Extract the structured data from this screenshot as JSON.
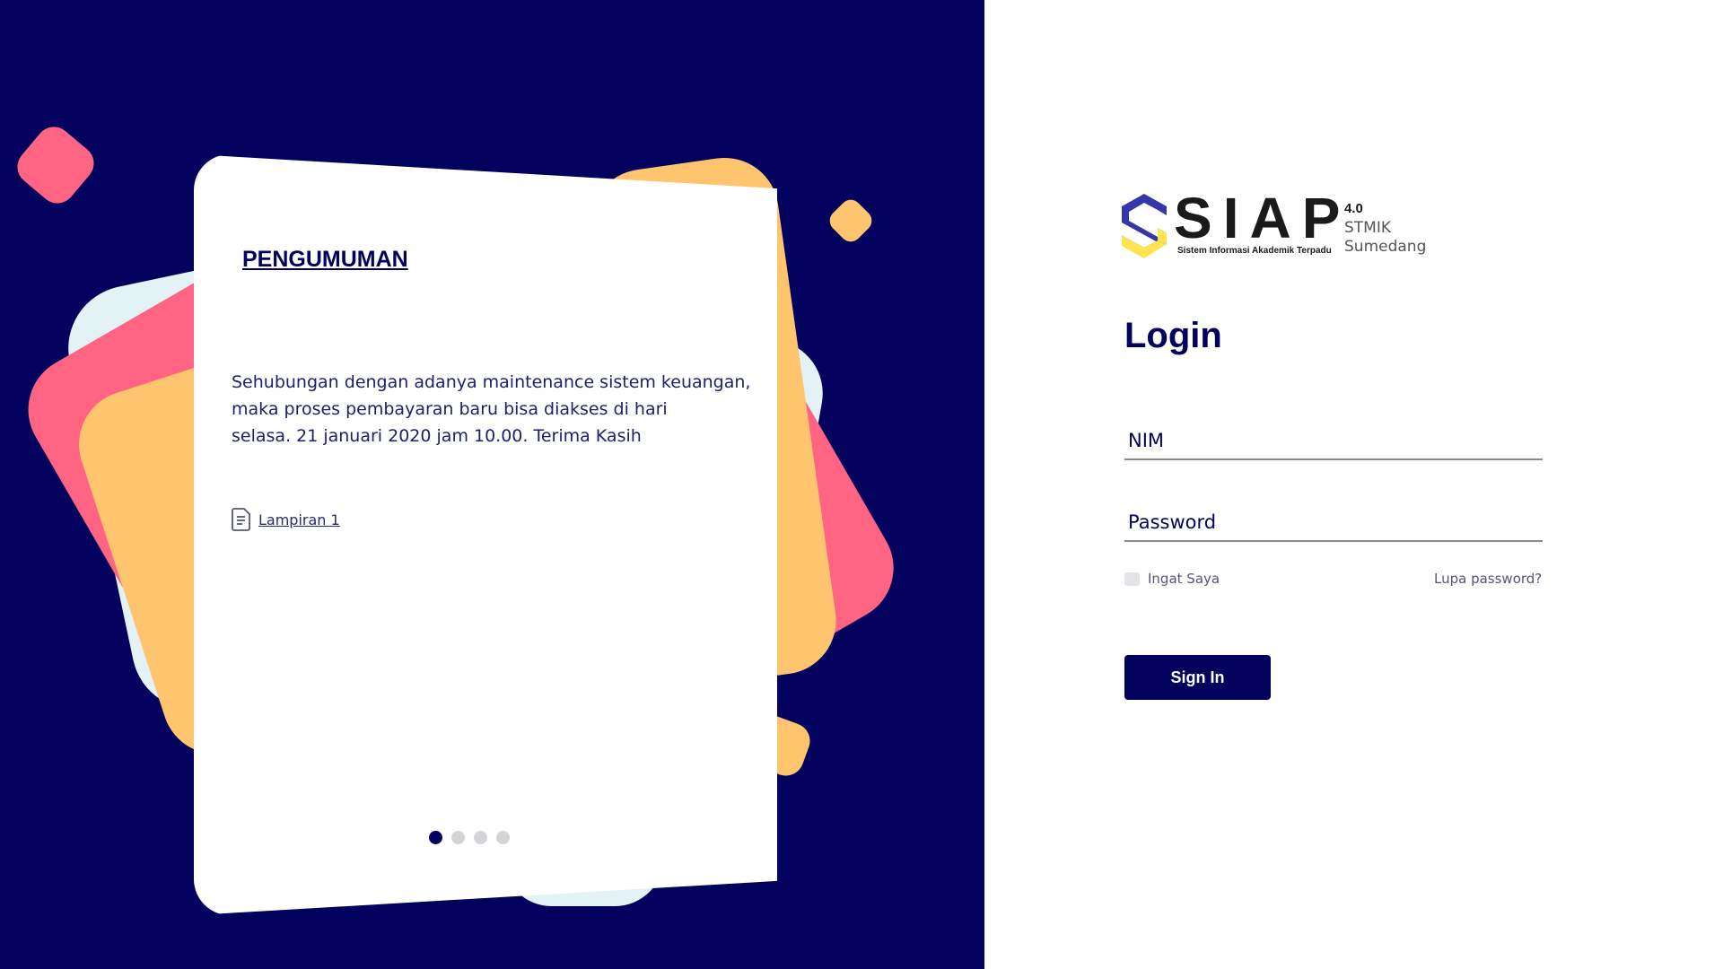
{
  "colors": {
    "navy": "#02025e",
    "pink": "#ff6482",
    "yellow": "#ffc56e",
    "light_cyan": "#e3f3f5",
    "logo_blue": "#3636a8",
    "logo_yellow": "#ffe34f"
  },
  "announcement": {
    "title": "PENGUMUMAN",
    "body_lines": [
      "Sehubungan dengan adanya maintenance sistem keuangan,",
      "maka proses pembayaran baru bisa diakses di hari",
      "selasa. 21 januari 2020 jam 10.00. Terima Kasih"
    ],
    "attachment_label": "Lampiran 1",
    "attachment_icon": "document-icon",
    "slides_total": 4,
    "slide_active": 1
  },
  "logo": {
    "wordmark": "SIAP",
    "tagline": "Sistem Informasi Akademik Terpadu",
    "version": "4.0",
    "institution_line1": "STMIK",
    "institution_line2": "Sumedang"
  },
  "login": {
    "title": "Login",
    "nim_placeholder": "NIM",
    "password_placeholder": "Password",
    "remember_label": "Ingat Saya",
    "forgot_label": "Lupa password?",
    "submit_label": "Sign In"
  }
}
